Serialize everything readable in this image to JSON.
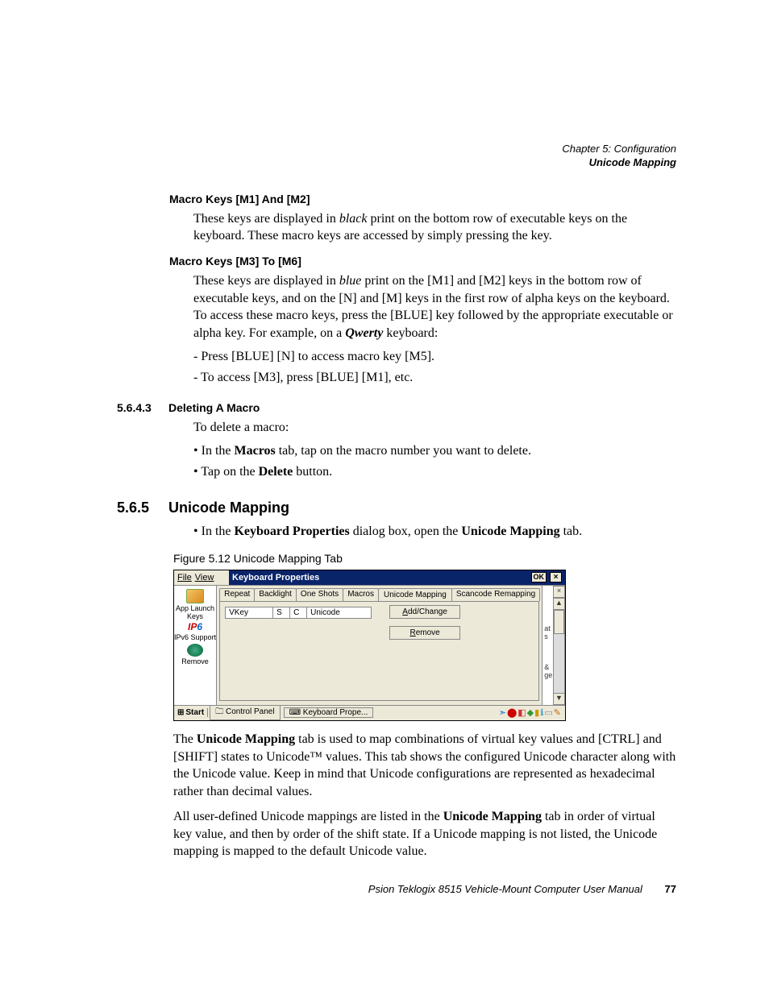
{
  "header": {
    "chapter": "Chapter 5: Configuration",
    "section": "Unicode Mapping"
  },
  "macro12": {
    "title": "Macro Keys [M1] And [M2]",
    "body_pre": "These keys are displayed in ",
    "body_em": "black",
    "body_post": " print on the bottom row of executable keys on the keyboard. These macro keys are accessed by simply pressing the key."
  },
  "macro36": {
    "title": "Macro Keys [M3] To [M6]",
    "body_pre": "These keys are displayed in ",
    "body_em": "blue",
    "body_mid": " print on the [M1] and [M2] keys in the bottom row of executable keys, and on the [N] and [M] keys in the first row of alpha keys on the keyboard. To access these macro keys, press the [BLUE] key followed by the appropriate executable or alpha key. For example, on a ",
    "body_em2": "Qwerty",
    "body_post": " keyboard:",
    "items": [
      "Press [BLUE] [N] to access macro key [M5].",
      "To access [M3], press [BLUE] [M1], etc."
    ]
  },
  "deleting": {
    "num": "5.6.4.3",
    "title": "Deleting A Macro",
    "intro": "To delete a macro:",
    "b1_pre": "In the ",
    "b1_bold": "Macros",
    "b1_post": " tab, tap on the macro number you want to delete.",
    "b2_pre": "Tap on the ",
    "b2_bold": "Delete",
    "b2_post": " button."
  },
  "unicode": {
    "num": "5.6.5",
    "title": "Unicode Mapping",
    "bullet_pre": "In the ",
    "bullet_bold1": "Keyboard Properties",
    "bullet_mid": " dialog box, open the ",
    "bullet_bold2": "Unicode Mapping",
    "bullet_post": " tab.",
    "figure_caption": "Figure 5.12 Unicode Mapping Tab"
  },
  "dialog": {
    "menu_file": "File",
    "menu_view": "View",
    "title": "Keyboard Properties",
    "ok": "OK",
    "close": "×",
    "tabs": [
      "Repeat",
      "Backlight",
      "One Shots",
      "Macros",
      "Unicode Mapping",
      "Scancode Remapping"
    ],
    "cols": {
      "vkey": "VKey",
      "s": "S",
      "c": "C",
      "unicode": "Unicode"
    },
    "btn_add": "Add/Change",
    "btn_remove": "Remove",
    "sidebar": {
      "app": "App Launch Keys",
      "ipv6": "IPv6 Support",
      "remove": "Remove"
    },
    "right_frag1": "at",
    "right_frag1b": "s",
    "right_frag2": "&",
    "right_frag2b": "ge",
    "taskbar": {
      "start": "Start",
      "cp": "Control Panel",
      "kp": "Keyboard Prope..."
    }
  },
  "para1": {
    "pre": "The ",
    "bold": "Unicode Mapping",
    "post": " tab is used to map combinations of virtual key values and [CTRL] and [SHIFT] states to Unicode™ values. This tab shows the configured Unicode character along with the Unicode value. Keep in mind that Unicode configurations are represented as hexadecimal rather than decimal values."
  },
  "para2": {
    "pre": "All user-defined Unicode mappings are listed in the ",
    "bold": "Unicode Mapping",
    "post": " tab in order of virtual key value, and then by order of the shift state. If a Unicode mapping is not listed, the Unicode mapping is mapped to the default Unicode value."
  },
  "footer": {
    "text": "Psion Teklogix 8515 Vehicle-Mount Computer User Manual",
    "page": "77"
  }
}
